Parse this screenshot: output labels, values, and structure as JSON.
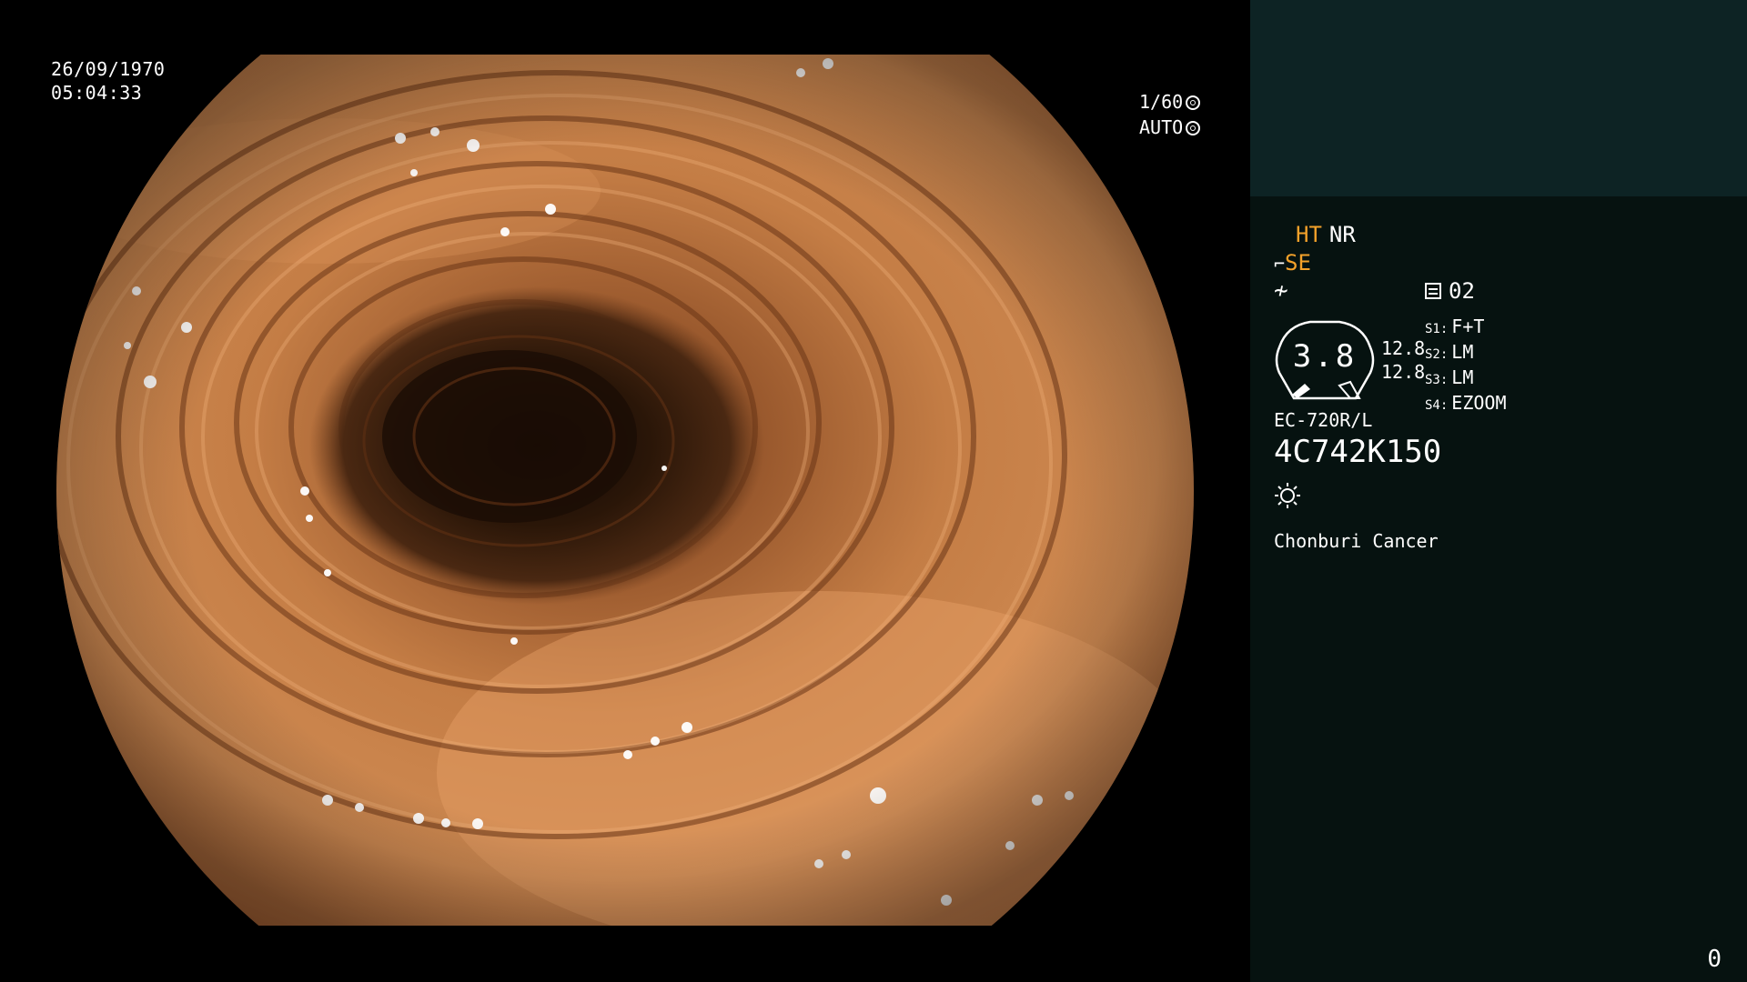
{
  "overlay": {
    "date": "26/09/1970",
    "time": "05:04:33",
    "shutter_speed": "1/60",
    "shutter_mode": "AUTO"
  },
  "panel": {
    "mode_ht": "HT",
    "mode_nr": "NR",
    "se_label": "SE",
    "tilde_label": "≁",
    "memory_label": "02",
    "gauge_value": "3.8",
    "value_top": "12.8",
    "value_bottom": "12.8",
    "slots": [
      {
        "key": "S1:",
        "value": "F+T"
      },
      {
        "key": "S2:",
        "value": "LM"
      },
      {
        "key": "S3:",
        "value": "LM"
      },
      {
        "key": "S4:",
        "value": "EZOOM"
      }
    ],
    "scope_model": "EC-720R/L",
    "serial_number": "4C742K150",
    "hospital": "Chonburi Cancer",
    "page_number": "0"
  },
  "colors": {
    "accent": "#f3a12a",
    "panel_bg": "#061210",
    "panel_top_bg": "#0d2324",
    "mucosa": "#c77a3e",
    "lumen": "#2a1608"
  }
}
